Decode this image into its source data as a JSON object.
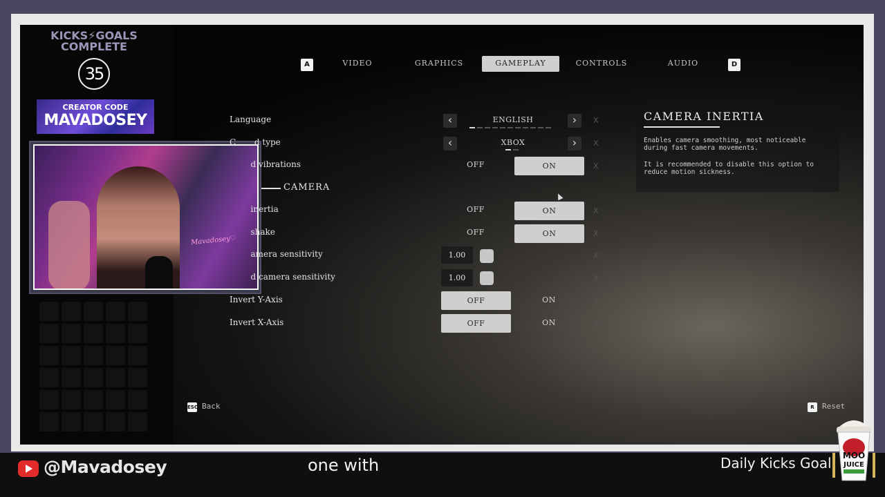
{
  "overlay": {
    "goal_title_line1": "KICKS⚡GOALS",
    "goal_title_line2": "COMPLETE",
    "goal_count": "35",
    "creator_label": "CREATOR CODE",
    "creator_name": "MAVADOSEY",
    "webcam_neon": "Mavadosey♡"
  },
  "tabs": {
    "left_key": "A",
    "right_key": "D",
    "items": [
      {
        "label": "VIDEO"
      },
      {
        "label": "GRAPHICS"
      },
      {
        "label": "GAMEPLAY"
      },
      {
        "label": "CONTROLS"
      },
      {
        "label": "AUDIO"
      }
    ],
    "active": "GAMEPLAY"
  },
  "settings": {
    "language": {
      "label": "Language",
      "value": "ENGLISH"
    },
    "controller": {
      "label": "C       d type",
      "value": "XBOX"
    },
    "vibrations": {
      "label": "        d vibrations",
      "off": "OFF",
      "on": "ON"
    },
    "section": "CAMERA",
    "camera_inertia": {
      "label": "        inertia",
      "off": "OFF",
      "on": "ON"
    },
    "camera_shake": {
      "label": "        shake",
      "off": "OFF",
      "on": "ON"
    },
    "camera_sensitivity": {
      "label": "        amera sensitivity",
      "value": "1.00"
    },
    "aim_sensitivity": {
      "label": "        d camera sensitivity",
      "value": "1.00"
    },
    "invert_y": {
      "label": "Invert Y-Axis",
      "off": "OFF",
      "on": "ON"
    },
    "invert_x": {
      "label": "Invert X-Axis",
      "off": "OFF",
      "on": "ON"
    },
    "reset_mark": "X"
  },
  "description": {
    "title": "CAMERA INERTIA",
    "para1": "Enables camera smoothing, most noticeable during fast camera movements.",
    "para2": "It is recommended to disable this option to reduce motion sickness."
  },
  "footer": {
    "back_key": "ESC",
    "back_label": "Back",
    "reset_key": "R",
    "reset_label": "Reset"
  },
  "stream_bar": {
    "handle": "@Mavadosey",
    "caption": "one with",
    "ticker": "Daily Kicks Goal",
    "sponsor_line1": "MOO",
    "sponsor_line2": "JUICE"
  },
  "colors": {
    "active_tab_bg": "#cfcfcf",
    "youtube_red": "#e32b2b",
    "overlay_purple": "#6f4dd8"
  }
}
